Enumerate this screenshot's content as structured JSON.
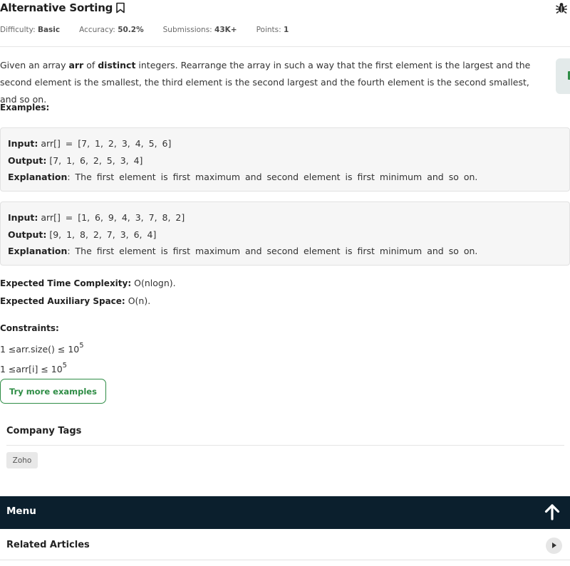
{
  "problem": {
    "title": "Alternative Sorting",
    "meta": {
      "difficulty_label": "Difficulty:",
      "difficulty_value": "Basic",
      "accuracy_label": "Accuracy:",
      "accuracy_value": "50.2%",
      "submissions_label": "Submissions:",
      "submissions_value": "43K+",
      "points_label": "Points:",
      "points_value": "1"
    },
    "statement": {
      "part1": "Given an array ",
      "bold1": "arr",
      "part2": " of ",
      "bold2": "distinct",
      "part3": " integers. Rearrange the array in such a way that the first element is the largest and the second element is the smallest, the third element is the second largest and the fourth element is the second smallest, and so on."
    },
    "examples_label": "Examples:",
    "examples": [
      {
        "input_label": "Input:",
        "input_value": "arr[] = [7, 1, 2, 3, 4, 5, 6]",
        "output_label": "Output:",
        "output_value": "[7, 1, 6, 2, 5, 3, 4]",
        "explanation_label": "Explanation",
        "explanation_value": ": The first element is first maximum and second element is first minimum and so on."
      },
      {
        "input_label": "Input:",
        "input_value": "arr[] = [1, 6, 9, 4, 3, 7, 8, 2]",
        "output_label": "Output:",
        "output_value": "[9, 1, 8, 2, 7, 3, 6, 4]",
        "explanation_label": "Explanation",
        "explanation_value": ": The first element is first maximum and second element is first minimum and so on."
      }
    ],
    "complexity": {
      "time_label": "Expected Time Complexity:",
      "time_value": " O(nlogn).",
      "space_label": "Expected Auxiliary Space:",
      "space_value": " O(n)."
    },
    "constraints": {
      "label": "Constraints:",
      "line1_text": "1 ≤arr.size() ≤ 10",
      "line1_exp": "5",
      "line2_text": "1 ≤arr[i] ≤ 10",
      "line2_exp": "5"
    },
    "try_more_label": "Try more examples"
  },
  "company": {
    "heading": "Company Tags",
    "tags": [
      "Zoho"
    ]
  },
  "menu": {
    "label": "Menu"
  },
  "related": {
    "label": "Related Articles"
  },
  "icons": {
    "bookmark": "bookmark-icon",
    "bug": "bug-icon",
    "up_arrow": "arrow-up-icon",
    "chevron": "chevron-right-icon"
  },
  "colors": {
    "accent_green": "#2f8d46",
    "menu_bg": "#0b1f2d",
    "example_bg": "#f6f6f6"
  }
}
